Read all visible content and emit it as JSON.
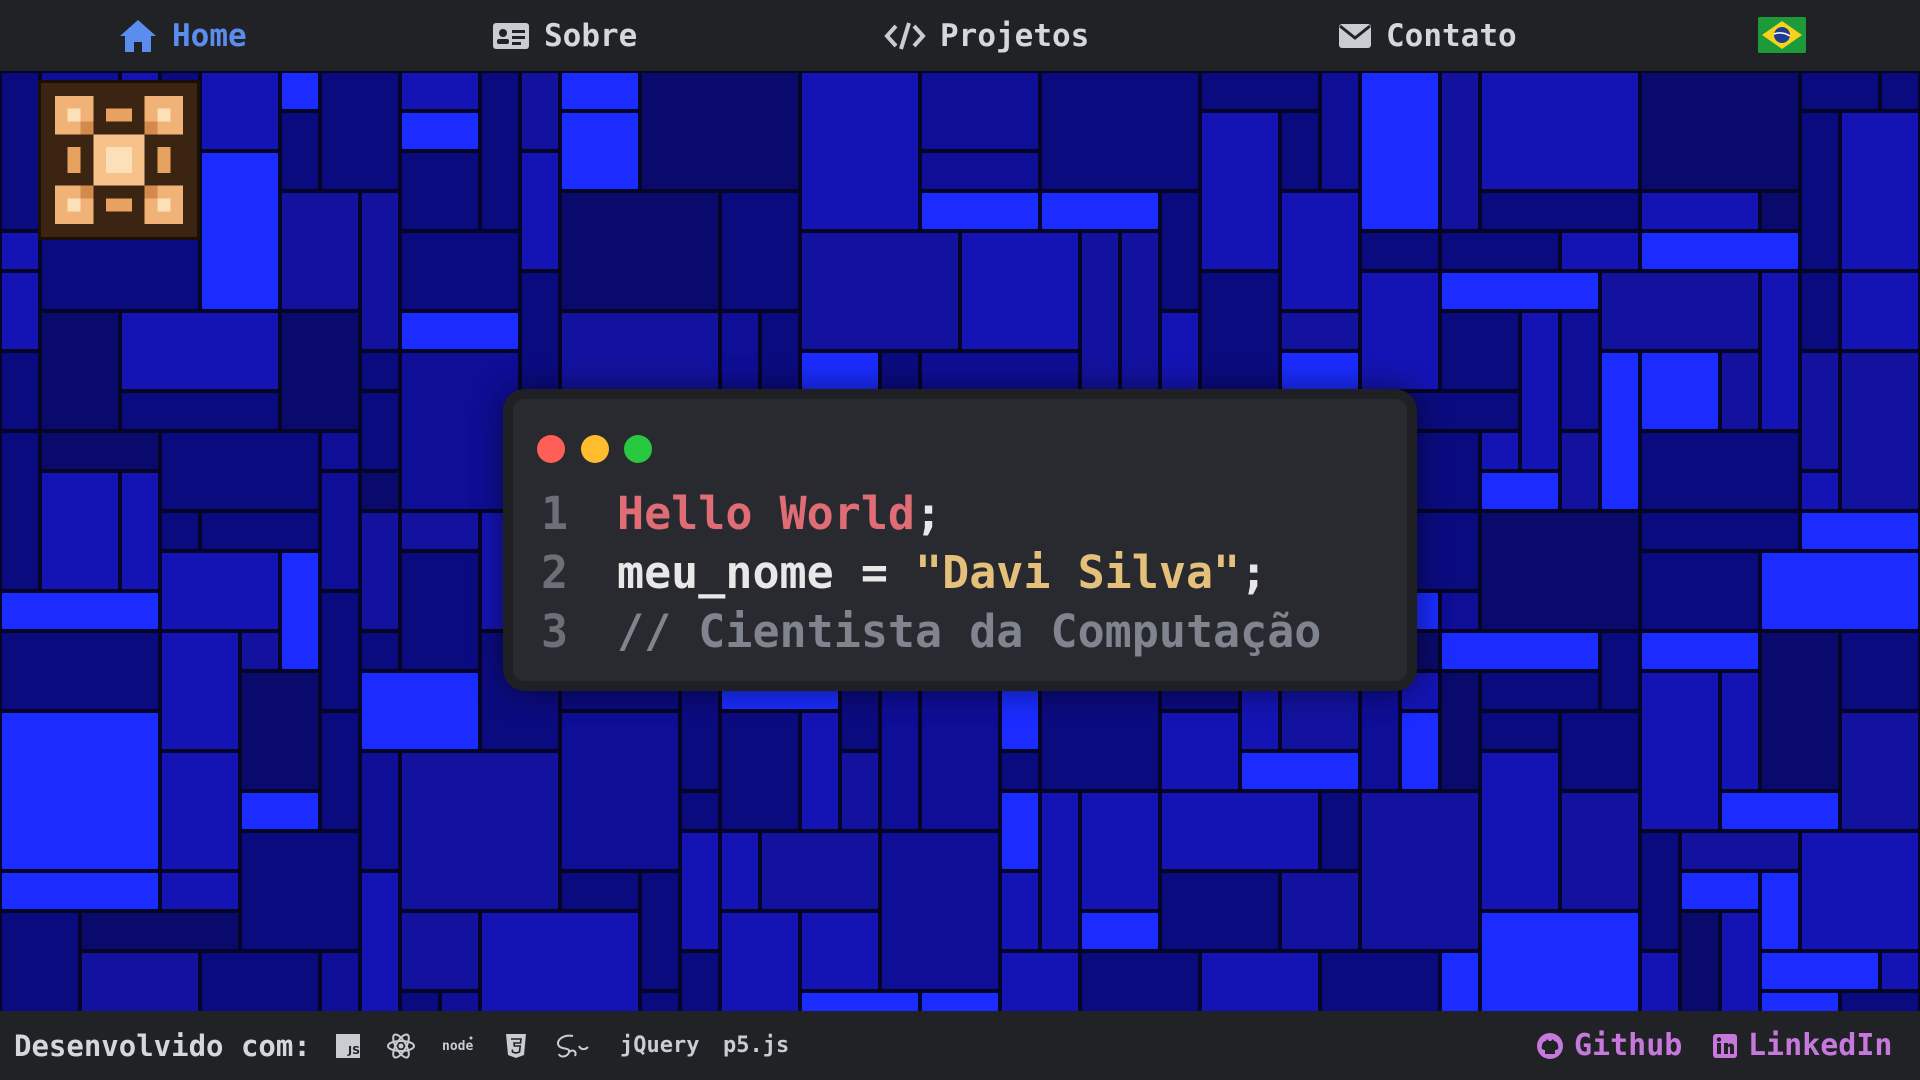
{
  "nav": {
    "items": [
      {
        "label": "Home",
        "icon": "home-icon",
        "active": true
      },
      {
        "label": "Sobre",
        "icon": "id-card-icon",
        "active": false
      },
      {
        "label": "Projetos",
        "icon": "code-icon",
        "active": false
      },
      {
        "label": "Contato",
        "icon": "envelope-icon",
        "active": false
      }
    ],
    "language_flag": "brazil-flag-icon"
  },
  "code": {
    "lines": [
      {
        "number": "1",
        "parts": [
          "Hello World",
          ";"
        ]
      },
      {
        "number": "2",
        "parts": [
          "meu_nome = ",
          "\"Davi Silva\"",
          ";"
        ]
      },
      {
        "number": "3",
        "parts": [
          "// Cientista da Computação"
        ]
      }
    ]
  },
  "footer": {
    "label": "Desenvolvido com:",
    "technologies": [
      {
        "name": "javascript-icon"
      },
      {
        "name": "react-icon"
      },
      {
        "name": "node-icon"
      },
      {
        "name": "html5-icon"
      },
      {
        "name": "sass-icon"
      },
      {
        "text": "jQuery"
      },
      {
        "text": "p5.js"
      }
    ],
    "links": [
      {
        "label": "Github",
        "icon": "github-icon"
      },
      {
        "label": "LinkedIn",
        "icon": "linkedin-icon"
      }
    ]
  },
  "colors": {
    "accent_blue": "#5b8def",
    "link_purple": "#c678dd",
    "code_red": "#e06c75",
    "code_yellow": "#e5c07b",
    "code_comment": "#7f848e",
    "tile_bright": "#1a2cff",
    "tile_mid": "#1414b4",
    "tile_dark": "#0b0b80",
    "dot_red": "#ff5f57",
    "dot_yellow": "#febc2e",
    "dot_green": "#28c840"
  }
}
